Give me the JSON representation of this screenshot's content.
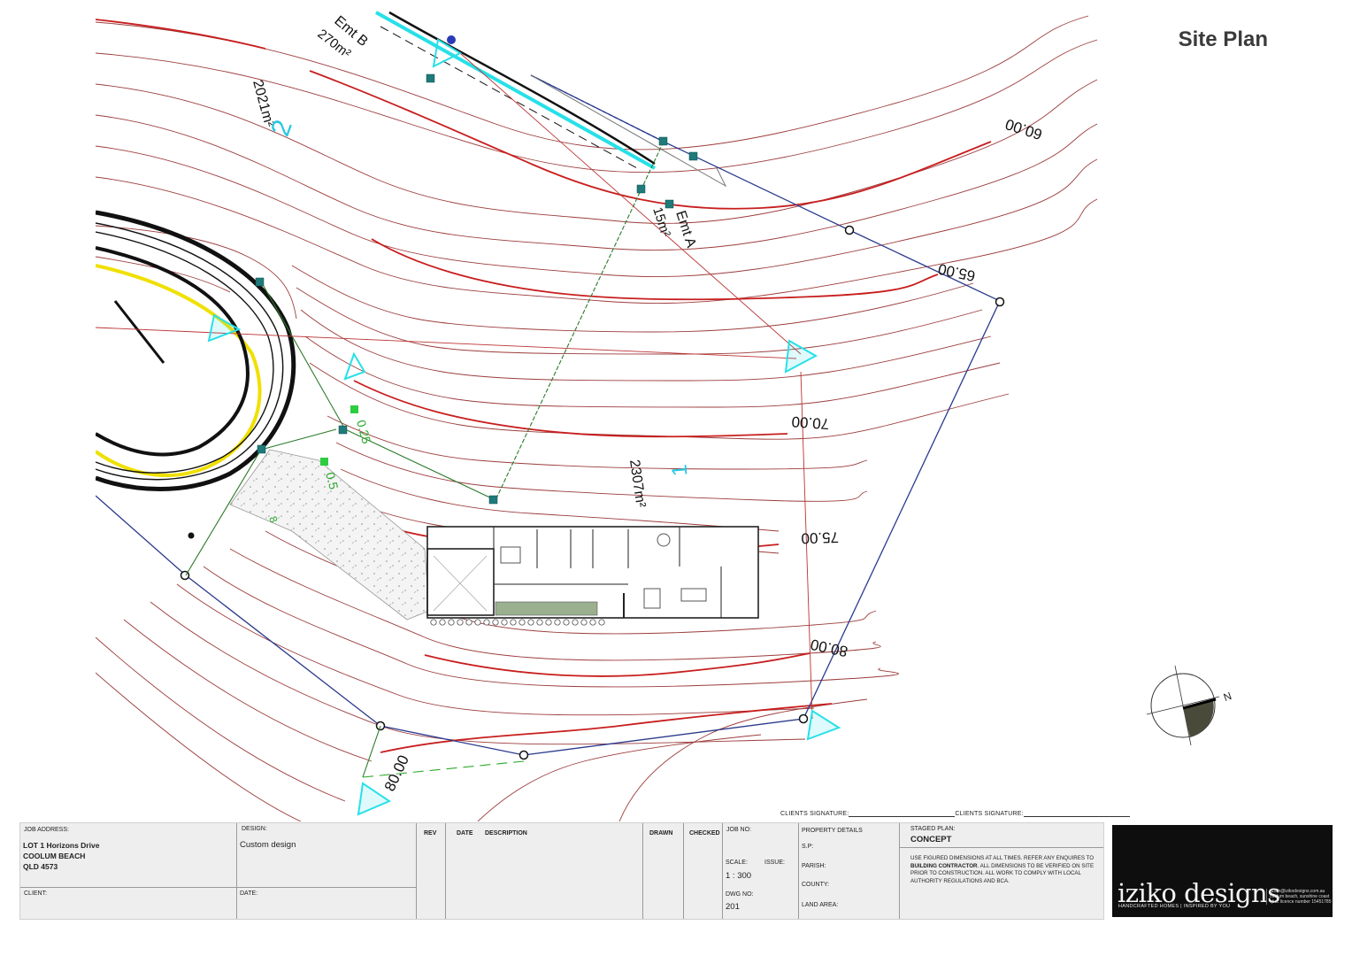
{
  "page": {
    "title": "Site Plan"
  },
  "plan": {
    "contour_labels": [
      "60.00",
      "65.00",
      "70.00",
      "75.00",
      "80.00",
      "80.00"
    ],
    "lot_labels": [
      {
        "lot": "1",
        "area": "2307m²"
      },
      {
        "lot": "2",
        "area": "2021m²"
      }
    ],
    "easements": [
      {
        "name": "Emt A",
        "area": "15m²"
      },
      {
        "name": "Emt B",
        "area": "270m²"
      }
    ],
    "spot_levels": [
      "0.25",
      "0.5",
      "8"
    ],
    "north_label": "N",
    "colors": {
      "contour_major": "#c81e1e",
      "contour_minor": "#8b1a1a",
      "boundary": "#2a3a8c",
      "easement": "#27e0e8",
      "setout": "#2a7a2a",
      "road_edge": "#f0e000"
    }
  },
  "signatures": {
    "label_1": "CLIENTS SIGNATURE:",
    "label_2": "CLIENTS SIGNATURE:"
  },
  "title_block": {
    "job_address_label": "JOB ADDRESS:",
    "job_address_lines": [
      "LOT 1 Horizons Drive",
      "COOLUM BEACH",
      "QLD 4573"
    ],
    "client_label": "CLIENT:",
    "design_label": "DESIGN:",
    "design_value": "Custom design",
    "date_label": "DATE:",
    "rev_label": "REV",
    "date_col_label": "DATE",
    "description_label": "DESCRIPTION",
    "drawn_label": "DRAWN",
    "checked_label": "CHECKED",
    "job_no_label": "JOB NO:",
    "scale_label": "SCALE:",
    "scale_value": "1 : 300",
    "issue_label": "ISSUE:",
    "dwg_no_label": "DWG NO:",
    "dwg_no_value": "201",
    "property_details_label": "PROPERTY DETAILS",
    "sp_label": "S.P:",
    "parish_label": "PARISH:",
    "county_label": "COUNTY:",
    "land_area_label": "LAND AREA:",
    "staged_plan_label": "STAGED PLAN:",
    "staged_plan_value": "CONCEPT",
    "notes_before": "USE FIGURED DIMENSIONS AT ALL TIMES. REFER ANY ENQUIRES TO ",
    "notes_bold": "BUILDING CONTRACTOR",
    "notes_after": ". ALL DIMENSIONS TO BE VERIFIED ON SITE PRIOR TO CONSTRUCTION. ALL WORK TO COMPLY WITH LOCAL AUTHORITY REGULATIONS AND BCA."
  },
  "logo": {
    "name": "iziko designs",
    "tagline": "HANDCRAFTED HOMES | INSPIRED BY YOU",
    "contact_lines": [
      "rustin@izikodesigns.com.au",
      "coolum beach, sunshine coast",
      "qbcc licence number 15451785"
    ]
  }
}
